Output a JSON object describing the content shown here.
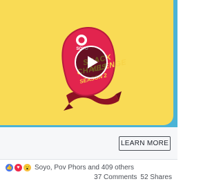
{
  "ad": {
    "logo": {
      "brand": "SOYO",
      "line1": "SNACK YES",
      "line2": "CHALLENGE",
      "season": "SEASON 2"
    },
    "cta_label": "LEARN MORE"
  },
  "reactions": {
    "icons": [
      "like-icon",
      "love-icon",
      "wow-icon"
    ],
    "summary": "Soyo, Pov Phors and 409 others"
  },
  "stats": {
    "comments": "37 Comments",
    "shares": "52 Shares"
  },
  "colors": {
    "background_blue": "#4bb3d6",
    "background_yellow": "#f9db55",
    "badge_red": "#e2244e",
    "like_blue": "#4a76e8",
    "love_red": "#f0284a"
  }
}
